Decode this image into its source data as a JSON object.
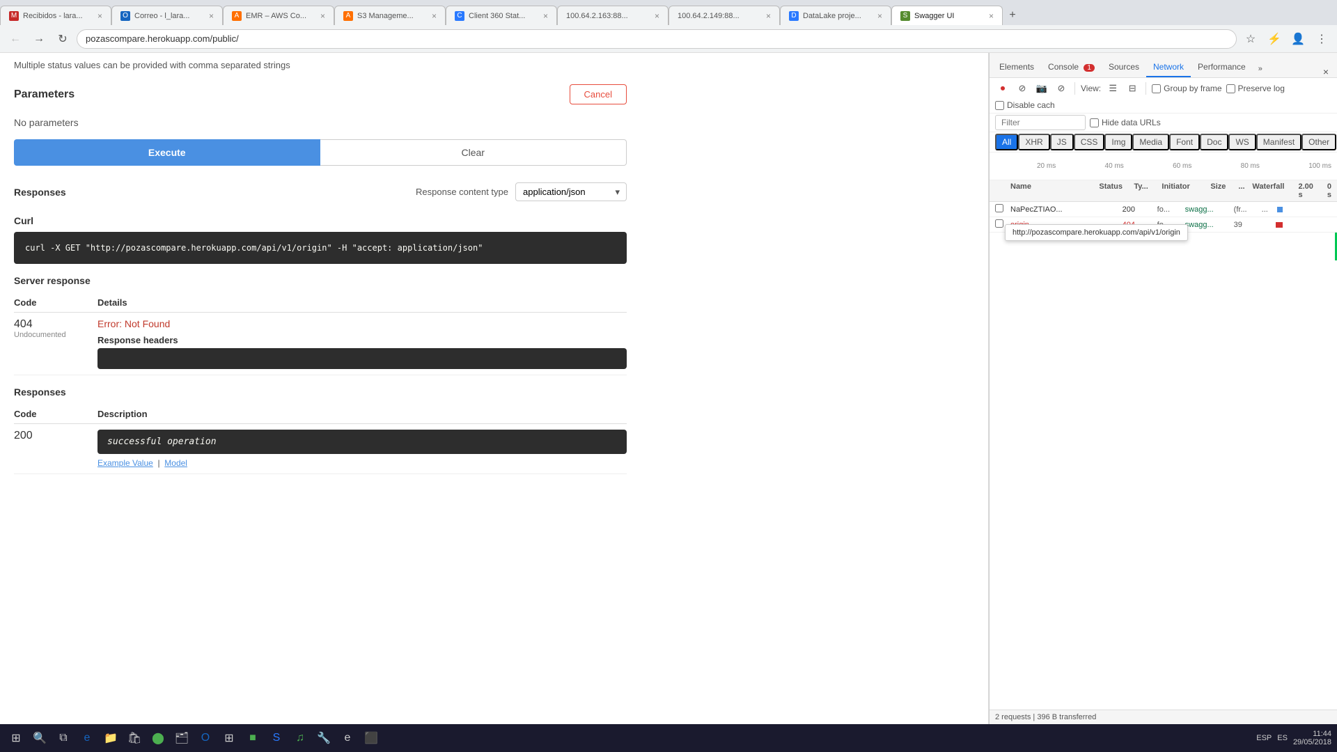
{
  "browser": {
    "tabs": [
      {
        "id": "gmail",
        "label": "Recibidos - lara...",
        "icon_color": "#c62828",
        "active": false,
        "icon_char": "M"
      },
      {
        "id": "correo",
        "label": "Correo - l_lara...",
        "icon_color": "#1565c0",
        "active": false,
        "icon_char": "O"
      },
      {
        "id": "emr",
        "label": "EMR – AWS Co...",
        "icon_color": "#ff6f00",
        "active": false,
        "icon_char": "A"
      },
      {
        "id": "s3",
        "label": "S3 Manageme...",
        "icon_color": "#ff6f00",
        "active": false,
        "icon_char": "A"
      },
      {
        "id": "client360",
        "label": "Client 360 Stat...",
        "icon_color": "#2979ff",
        "active": false,
        "icon_char": "C"
      },
      {
        "id": "ip1",
        "label": "100.64.2.163:88...",
        "icon_color": "#555",
        "active": false,
        "icon_char": "●"
      },
      {
        "id": "ip2",
        "label": "100.64.2.149:88...",
        "icon_color": "#555",
        "active": false,
        "icon_char": "●"
      },
      {
        "id": "datalake",
        "label": "DataLake proje...",
        "icon_color": "#2979ff",
        "active": false,
        "icon_char": "D"
      },
      {
        "id": "swagger",
        "label": "Swagger UI",
        "icon_color": "#558b2f",
        "active": true,
        "icon_char": "S"
      }
    ],
    "address": "pozascompare.herokuapp.com/public/",
    "new_tab_btn": "+"
  },
  "swagger": {
    "status_text": "Multiple status values can be provided with comma separated strings",
    "parameters_label": "Parameters",
    "cancel_btn": "Cancel",
    "no_params": "No parameters",
    "execute_btn": "Execute",
    "clear_btn": "Clear",
    "responses_label": "Responses",
    "response_content_label": "Response content type",
    "response_content_value": "application/json",
    "curl_label": "Curl",
    "curl_cmd": "curl -X GET \"http://pozascompare.herokuapp.com/api/v1/origin\" -H  \"accept: application/json\"",
    "server_response_label": "Server response",
    "code_col": "Code",
    "details_col": "Details",
    "status_code": "404",
    "undocumented": "Undocumented",
    "error_text": "Error: Not Found",
    "response_headers_label": "Response headers",
    "response_headers_value": "",
    "responses_section_label": "Responses",
    "code_col2": "Code",
    "desc_col": "Description",
    "code_200": "200",
    "success_operation": "successful operation",
    "example_value": "Example Value",
    "model_label": "Model"
  },
  "devtools": {
    "tabs": [
      "Elements",
      "Console",
      "Sources",
      "Network",
      "Performance",
      "»"
    ],
    "active_tab": "Network",
    "error_badge": "1",
    "toolbar": {
      "record_icon": "⏺",
      "stop_icon": "⊘",
      "camera_icon": "📷",
      "filter_icon": "⊘",
      "view_icon1": "☰",
      "view_icon2": "⊟",
      "group_by_frame": "Group by frame",
      "preserve_log": "Preserve log",
      "disable_cache": "Disable cach",
      "filter_placeholder": "Filter",
      "hide_data_urls": "Hide data URLs"
    },
    "filter_types": [
      "All",
      "XHR",
      "JS",
      "CSS",
      "Img",
      "Media",
      "Font",
      "Doc",
      "WS",
      "Manifest",
      "Other"
    ],
    "active_filter": "All",
    "timeline_labels": [
      "20 ms",
      "40 ms",
      "60 ms",
      "80 ms",
      "100 ms"
    ],
    "table_headers": [
      "",
      "Name",
      "Status",
      "Ty...",
      "Initiator",
      "Size",
      "...",
      "Waterfall",
      "2.00 s",
      "0 s"
    ],
    "rows": [
      {
        "id": "row1",
        "name": "NaPecZTIAO...",
        "status": "200",
        "type": "fo...",
        "initiator": "swagg...",
        "size": "(fr...",
        "dots": "...",
        "tooltip": "http://pozascompare.herokuapp.com/api/v1/origin",
        "has_tooltip": true
      },
      {
        "id": "row2",
        "name": "origin",
        "status": "404",
        "type": "fo...",
        "initiator": "swagg...",
        "size": "39",
        "dots": "",
        "has_tooltip": false
      }
    ],
    "footer": "2 requests | 396 B transferred",
    "tooltip_url": "http://pozascompare.herokuapp.com/api/v1/origin"
  },
  "taskbar": {
    "lang": "ESP",
    "locale": "ES",
    "time": "11:44",
    "date": "29/05/2018"
  }
}
